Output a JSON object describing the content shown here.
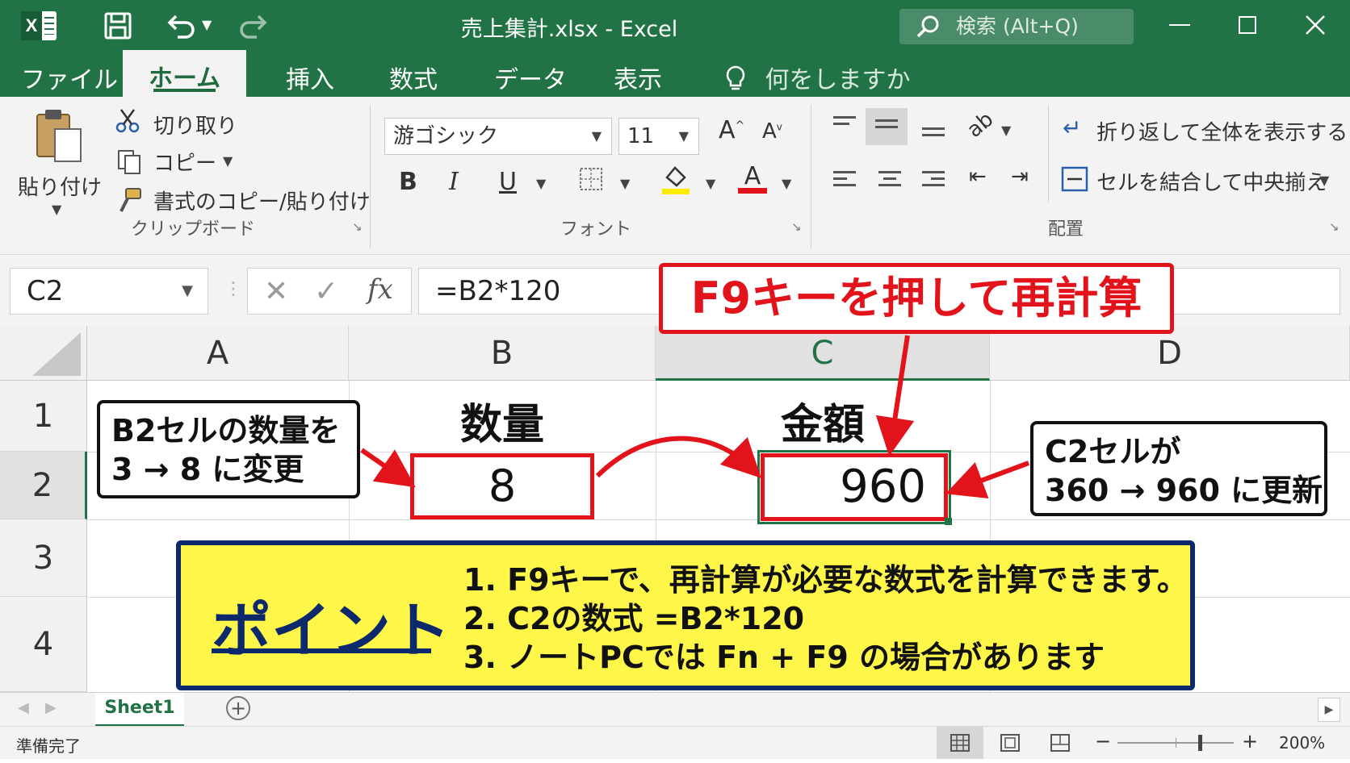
{
  "window": {
    "title": "売上集計.xlsx  -  Excel",
    "search_placeholder": "検索 (Alt+Q)"
  },
  "tabs": [
    "ファイル",
    "ホーム",
    "挿入",
    "数式",
    "データ",
    "表示"
  ],
  "tell_me": "何をしますか",
  "ribbon": {
    "clipboard": {
      "paste": "貼り付け",
      "cut": "切り取り",
      "copy": "コピー",
      "format_painter": "書式のコピー/貼り付け",
      "group_label": "クリップボード"
    },
    "font": {
      "font_name": "游ゴシック",
      "font_size": "11",
      "bold": "B",
      "italic": "I",
      "underline": "U",
      "group_label": "フォント",
      "highlight_color": "#ffeb00",
      "font_color": "#e3131b"
    },
    "alignment": {
      "wrap_text": "折り返して全体を表示する",
      "merge_center": "セルを結合して中央揃え",
      "group_label": "配置"
    }
  },
  "formula_bar": {
    "name_box": "C2",
    "formula": "=B2*120"
  },
  "grid": {
    "columns": [
      "A",
      "B",
      "C",
      "D"
    ],
    "rows": [
      "1",
      "2",
      "3",
      "4"
    ],
    "cells": {
      "B1": "数量",
      "C1": "金額",
      "B2": "8",
      "C2": "960"
    }
  },
  "annotations": {
    "f9_title": "F9キーを押して再計算",
    "b2_note_line1": "B2セルの数量を",
    "b2_note_line2": "3 → 8 に変更",
    "c2_note_line1": "C2セルが",
    "c2_note_line2": "360 → 960 に更新",
    "point_title": "ポイント",
    "point_items": [
      "1. F9キーで、再計算が必要な数式を計算できます。",
      "2. C2の数式 =B2*120",
      "3. ノートPCでは Fn + F9 の場合があります"
    ]
  },
  "sheet_tabs": [
    "Sheet1"
  ],
  "status": {
    "ready": "準備完了",
    "zoom": "200%"
  },
  "colors": {
    "excel_green": "#217346",
    "callout_red": "#e3131b",
    "point_bg": "#fff64a",
    "point_border": "#0c2a6b"
  }
}
